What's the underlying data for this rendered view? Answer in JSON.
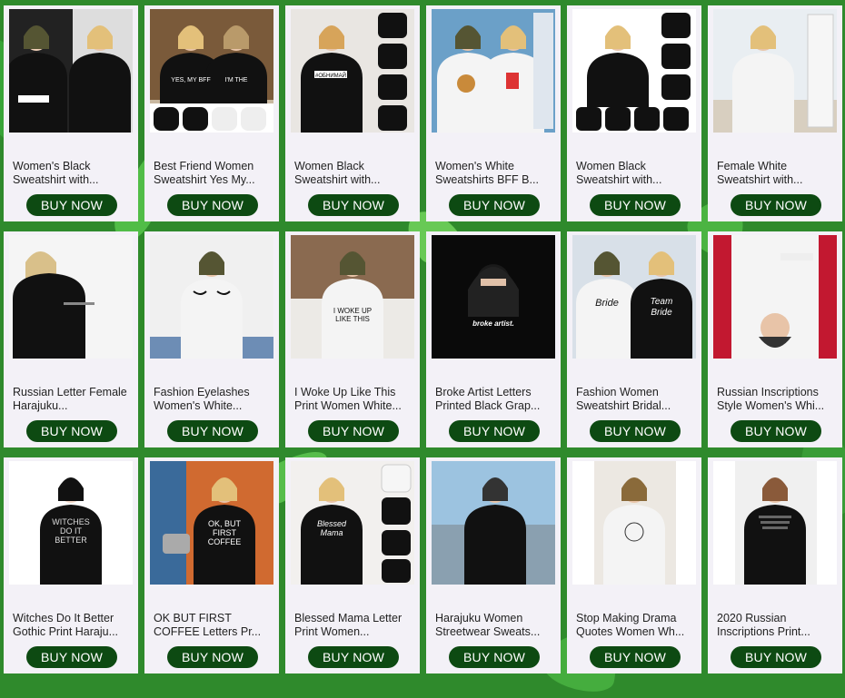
{
  "colors": {
    "button_bg": "#0d4a12",
    "button_text": "#ffffff",
    "card_bg": "#f3f1f7",
    "page_bg": "#2f8a2c"
  },
  "products": [
    {
      "title": "Women's Black Sweatshirt with...",
      "button": "BUY NOW",
      "image_icon": "sweatshirt-photo"
    },
    {
      "title": "Best Friend Women Sweatshirt Yes My...",
      "button": "BUY NOW",
      "image_icon": "sweatshirt-photo"
    },
    {
      "title": "Women Black Sweatshirt with...",
      "button": "BUY NOW",
      "image_icon": "sweatshirt-photo"
    },
    {
      "title": "Women's White Sweatshirts BFF B...",
      "button": "BUY NOW",
      "image_icon": "sweatshirt-photo"
    },
    {
      "title": "Women Black Sweatshirt with...",
      "button": "BUY NOW",
      "image_icon": "sweatshirt-photo"
    },
    {
      "title": "Female White Sweatshirt with...",
      "button": "BUY NOW",
      "image_icon": "sweatshirt-photo"
    },
    {
      "title": "Russian Letter Female Harajuku...",
      "button": "BUY NOW",
      "image_icon": "sweatshirt-photo"
    },
    {
      "title": "Fashion Eyelashes Women's White...",
      "button": "BUY NOW",
      "image_icon": "sweatshirt-photo"
    },
    {
      "title": "I Woke Up Like This Print Women White...",
      "button": "BUY NOW",
      "image_icon": "sweatshirt-photo"
    },
    {
      "title": "Broke Artist Letters Printed Black Grap...",
      "button": "BUY NOW",
      "image_icon": "sweatshirt-photo"
    },
    {
      "title": "Fashion Women Sweatshirt Bridal...",
      "button": "BUY NOW",
      "image_icon": "sweatshirt-photo"
    },
    {
      "title": "Russian Inscriptions Style Women's Whi...",
      "button": "BUY NOW",
      "image_icon": "sweatshirt-photo"
    },
    {
      "title": "Witches Do It Better Gothic Print Haraju...",
      "button": "BUY NOW",
      "image_icon": "sweatshirt-photo"
    },
    {
      "title": "OK BUT FIRST COFFEE Letters Pr...",
      "button": "BUY NOW",
      "image_icon": "sweatshirt-photo"
    },
    {
      "title": "Blessed Mama Letter Print Women...",
      "button": "BUY NOW",
      "image_icon": "sweatshirt-photo"
    },
    {
      "title": "Harajuku Women Streetwear Sweats...",
      "button": "BUY NOW",
      "image_icon": "sweatshirt-photo"
    },
    {
      "title": "Stop Making Drama Quotes Women Wh...",
      "button": "BUY NOW",
      "image_icon": "sweatshirt-photo"
    },
    {
      "title": "2020 Russian Inscriptions Print...",
      "button": "BUY NOW",
      "image_icon": "sweatshirt-photo"
    }
  ],
  "image_texts": {
    "p2": "YES, MY BFF IS CRAZY",
    "p2b": "I'M THE CRAZY BFF",
    "p3": "#ОБНИМАЙ",
    "p9": "I WOKE UP LIKE THIS",
    "p10": "broke artist.",
    "p11a": "Bride",
    "p11b": "Team Bride",
    "p13": "WITCHES DO IT BETTER",
    "p14": "OK, BUT FIRST COFFEE",
    "p15": "Blessed Mama"
  }
}
